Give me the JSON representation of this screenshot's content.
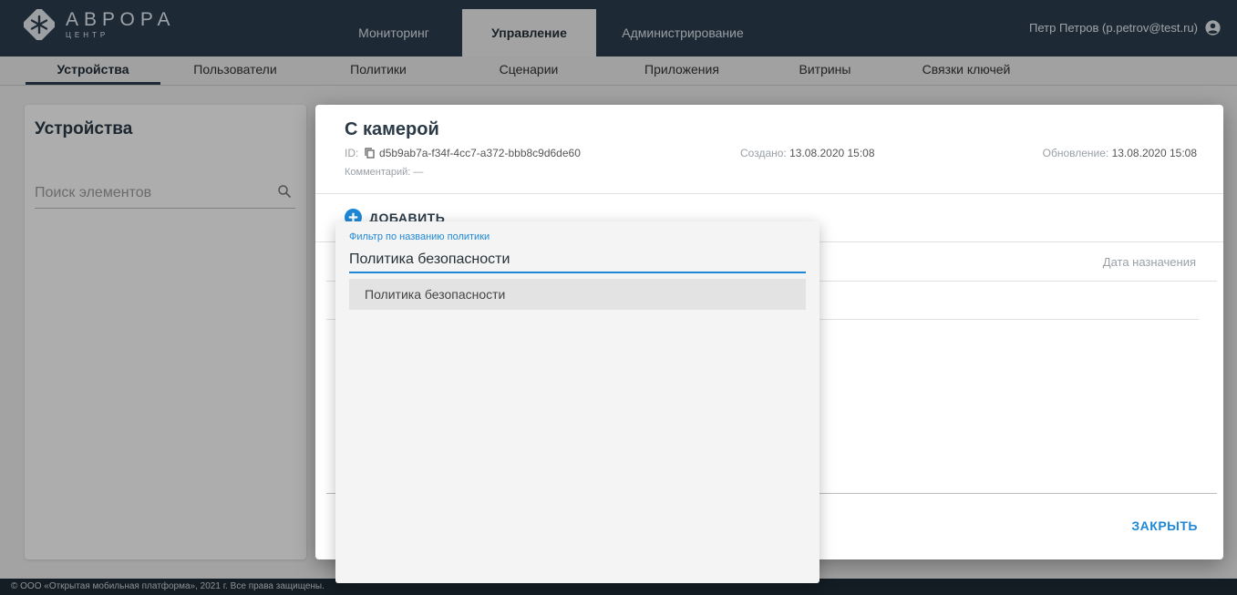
{
  "brand": {
    "title": "АВРОРА",
    "subtitle": "ЦЕНТР"
  },
  "main_nav": [
    {
      "label": "Мониторинг",
      "active": false
    },
    {
      "label": "Управление",
      "active": true
    },
    {
      "label": "Администрирование",
      "active": false
    }
  ],
  "user": {
    "label": "Петр Петров (p.petrov@test.ru)",
    "icon": "account-circle-icon"
  },
  "sub_nav": [
    {
      "label": "Устройства",
      "active": true
    },
    {
      "label": "Пользователи",
      "active": false
    },
    {
      "label": "Политики",
      "active": false
    },
    {
      "label": "Сценарии",
      "active": false
    },
    {
      "label": "Приложения",
      "active": false
    },
    {
      "label": "Витрины",
      "active": false
    },
    {
      "label": "Связки ключей",
      "active": false
    }
  ],
  "left_panel": {
    "title": "Устройства",
    "search_placeholder": "Поиск элементов"
  },
  "dialog": {
    "title": "С камерой",
    "id_label": "ID:",
    "id_value": "d5b9ab7a-f34f-4cc7-a372-bbb8c9d6de60",
    "created_label": "Создано:",
    "created_value": "13.08.2020 15:08",
    "updated_label": "Обновление:",
    "updated_value": "13.08.2020 15:08",
    "comment": "Комментарий: —",
    "add_label": "ДОБАВИТЬ",
    "column_header": "Дата назначения",
    "close_label": "ЗАКРЫТЬ"
  },
  "policy_filter": {
    "label": "Фильтр по названию политики",
    "value": "Политика безопасности",
    "options": [
      "Политика безопасности"
    ]
  },
  "footer": {
    "text": "© ООО «Открытая мобильная платформа», 2021 г. Все права защищены."
  },
  "colors": {
    "header_bg": "#2c3e50",
    "accent": "#1e88d6",
    "footer_bg": "#1e2b36"
  }
}
